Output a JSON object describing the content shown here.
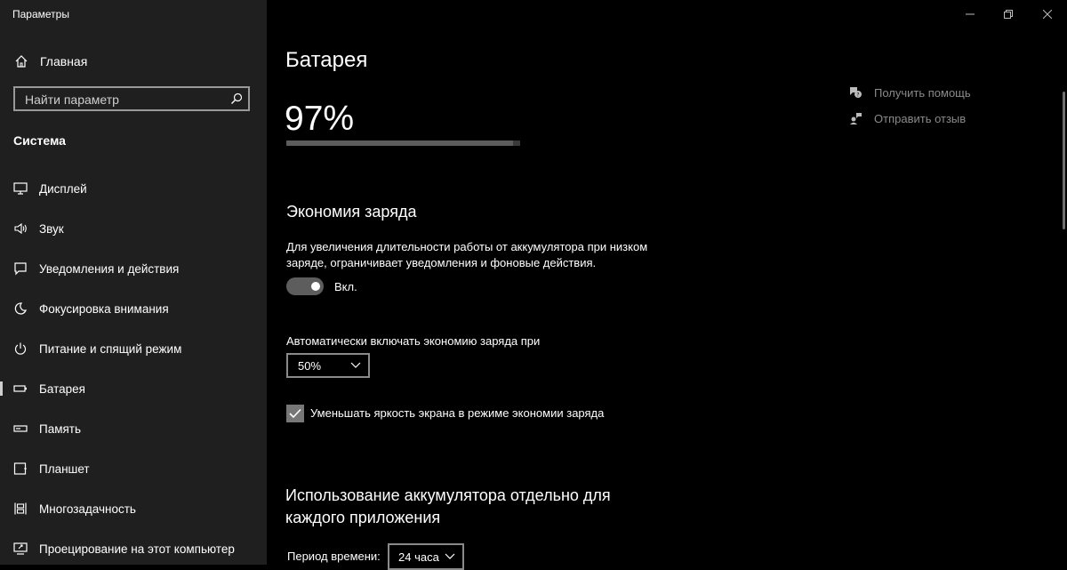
{
  "window": {
    "title": "Параметры"
  },
  "sidebar": {
    "home_label": "Главная",
    "search_placeholder": "Найти параметр",
    "section": "Система",
    "items": [
      {
        "label": "Дисплей",
        "icon": "monitor-icon"
      },
      {
        "label": "Звук",
        "icon": "speaker-icon"
      },
      {
        "label": "Уведомления и действия",
        "icon": "notification-icon"
      },
      {
        "label": "Фокусировка внимания",
        "icon": "moon-icon"
      },
      {
        "label": "Питание и спящий режим",
        "icon": "power-icon"
      },
      {
        "label": "Батарея",
        "icon": "battery-icon",
        "active": true
      },
      {
        "label": "Память",
        "icon": "storage-icon"
      },
      {
        "label": "Планшет",
        "icon": "tablet-icon"
      },
      {
        "label": "Многозадачность",
        "icon": "multitasking-icon"
      },
      {
        "label": "Проецирование на этот компьютер",
        "icon": "projecting-icon"
      }
    ]
  },
  "main": {
    "title": "Батарея",
    "battery": {
      "percent_text": "97%",
      "level": 0.97
    },
    "saver": {
      "heading": "Экономия заряда",
      "description": "Для увеличения длительности работы от аккумулятора при низком заряде, ограничивает уведомления и фоновые действия.",
      "toggle_state": "Вкл.",
      "toggle_on": true,
      "auto_label": "Автоматически включать экономию заряда при",
      "auto_value": "50%",
      "brightness_label": "Уменьшать яркость экрана в режиме экономии заряда",
      "brightness_checked": true
    },
    "usage": {
      "heading": "Использование аккумулятора отдельно для каждого приложения",
      "period_label": "Период времени:",
      "period_value": "24 часа"
    }
  },
  "help": {
    "get_help": "Получить помощь",
    "feedback": "Отправить отзыв"
  },
  "colors": {
    "background": "#000000",
    "sidebar": "#1f1f1f",
    "muted_text": "#8a8a8a"
  }
}
